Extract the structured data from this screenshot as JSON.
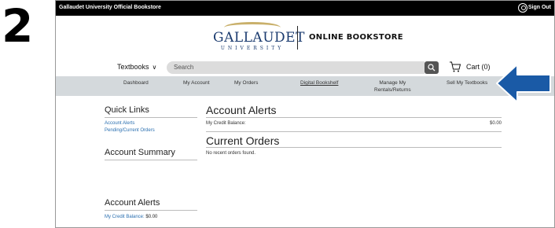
{
  "step_number": "2",
  "topbar": {
    "store_name": "Gallaudet University Official Bookstore",
    "sign_out": "Sign Out"
  },
  "logo": {
    "name": "GALLAUDET",
    "sub": "UNIVERSITY",
    "tagline": "ONLINE BOOKSTORE"
  },
  "search": {
    "category": "Textbooks",
    "placeholder": "Search",
    "cart_label": "Cart (0)"
  },
  "nav": {
    "dashboard": "Dashboard",
    "my_account": "My Account",
    "my_orders": "My Orders",
    "digital_bookshelf": "Digital Bookshelf",
    "manage_rentals_line1": "Manage My",
    "manage_rentals_line2": "Rentals/Returns",
    "sell_textbooks": "Sell My Textbooks"
  },
  "sidebar": {
    "quick_links_title": "Quick Links",
    "quick_links": [
      "Account Alerts",
      "Pending/Current Orders"
    ],
    "account_summary_title": "Account Summary",
    "account_alerts_title": "Account Alerts",
    "credit_label": "My Credit Balance:",
    "credit_value": "$0.00"
  },
  "main": {
    "alerts_title": "Account Alerts",
    "credit_label": "My Credit Balance:",
    "credit_value": "$0.00",
    "orders_title": "Current Orders",
    "no_orders": "No recent orders found."
  },
  "colors": {
    "accent_blue": "#1a5aa6",
    "link_blue": "#2a6fb0",
    "nav_bg": "#d4d9dc",
    "logo_gold": "#c9b06b",
    "logo_navy": "#1b3b6f"
  }
}
